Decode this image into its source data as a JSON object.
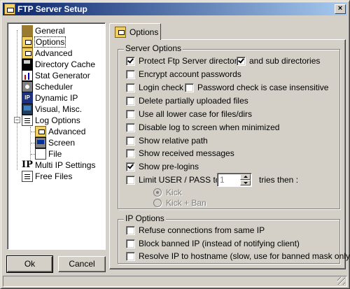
{
  "window": {
    "title": "FTP Server Setup",
    "close_label": "×"
  },
  "tree": {
    "items": [
      {
        "label": "General"
      },
      {
        "label": "Options"
      },
      {
        "label": "Advanced"
      },
      {
        "label": "Directory Cache"
      },
      {
        "label": "Stat Generator"
      },
      {
        "label": "Scheduler"
      },
      {
        "label": "Dynamic IP"
      },
      {
        "label": "Visual, Misc."
      },
      {
        "label": "Log Options"
      },
      {
        "label": "Advanced"
      },
      {
        "label": "Screen"
      },
      {
        "label": "File"
      },
      {
        "label": "Multi IP Settings"
      },
      {
        "label": "Free Files"
      }
    ],
    "expander": "−",
    "ip_icon_text": "IP",
    "bigip_icon_text": "IP"
  },
  "buttons": {
    "ok": "Ok",
    "cancel": "Cancel"
  },
  "tab": {
    "label": "Options"
  },
  "server_options": {
    "title": "Server Options",
    "protect": {
      "label": "Protect Ftp Server directory",
      "checked": true
    },
    "subdirs": {
      "label": "and sub directories",
      "checked": true
    },
    "encrypt": {
      "label": "Encrypt account passwords",
      "checked": false
    },
    "login_check": {
      "label": "Login check",
      "checked": false
    },
    "password_check": {
      "label": "Password check  is case insensitive",
      "checked": false
    },
    "delete_partial": {
      "label": "Delete partially uploaded files",
      "checked": false
    },
    "lower_case": {
      "label": "Use all lower case for files/dirs",
      "checked": false
    },
    "disable_log": {
      "label": "Disable log to screen when minimized",
      "checked": false
    },
    "relative_path": {
      "label": "Show relative path",
      "checked": false
    },
    "received_messages": {
      "label": "Show received messages",
      "checked": false
    },
    "prelogins": {
      "label": "Show pre-logins",
      "checked": true
    },
    "limit_user": {
      "label": "Limit USER / PASS to",
      "checked": false
    },
    "tries_value": "1",
    "tries_then": "tries then :",
    "radio_kick": "Kick",
    "radio_kick_ban": "Kick + Ban"
  },
  "ip_options": {
    "title": "IP Options",
    "refuse": {
      "label": "Refuse connections from same IP",
      "checked": false
    },
    "block_banned": {
      "label": "Block banned IP (instead of notifying client)",
      "checked": false
    },
    "resolve": {
      "label": "Resolve IP to hostname (slow, use for banned mask only)",
      "checked": false
    }
  }
}
